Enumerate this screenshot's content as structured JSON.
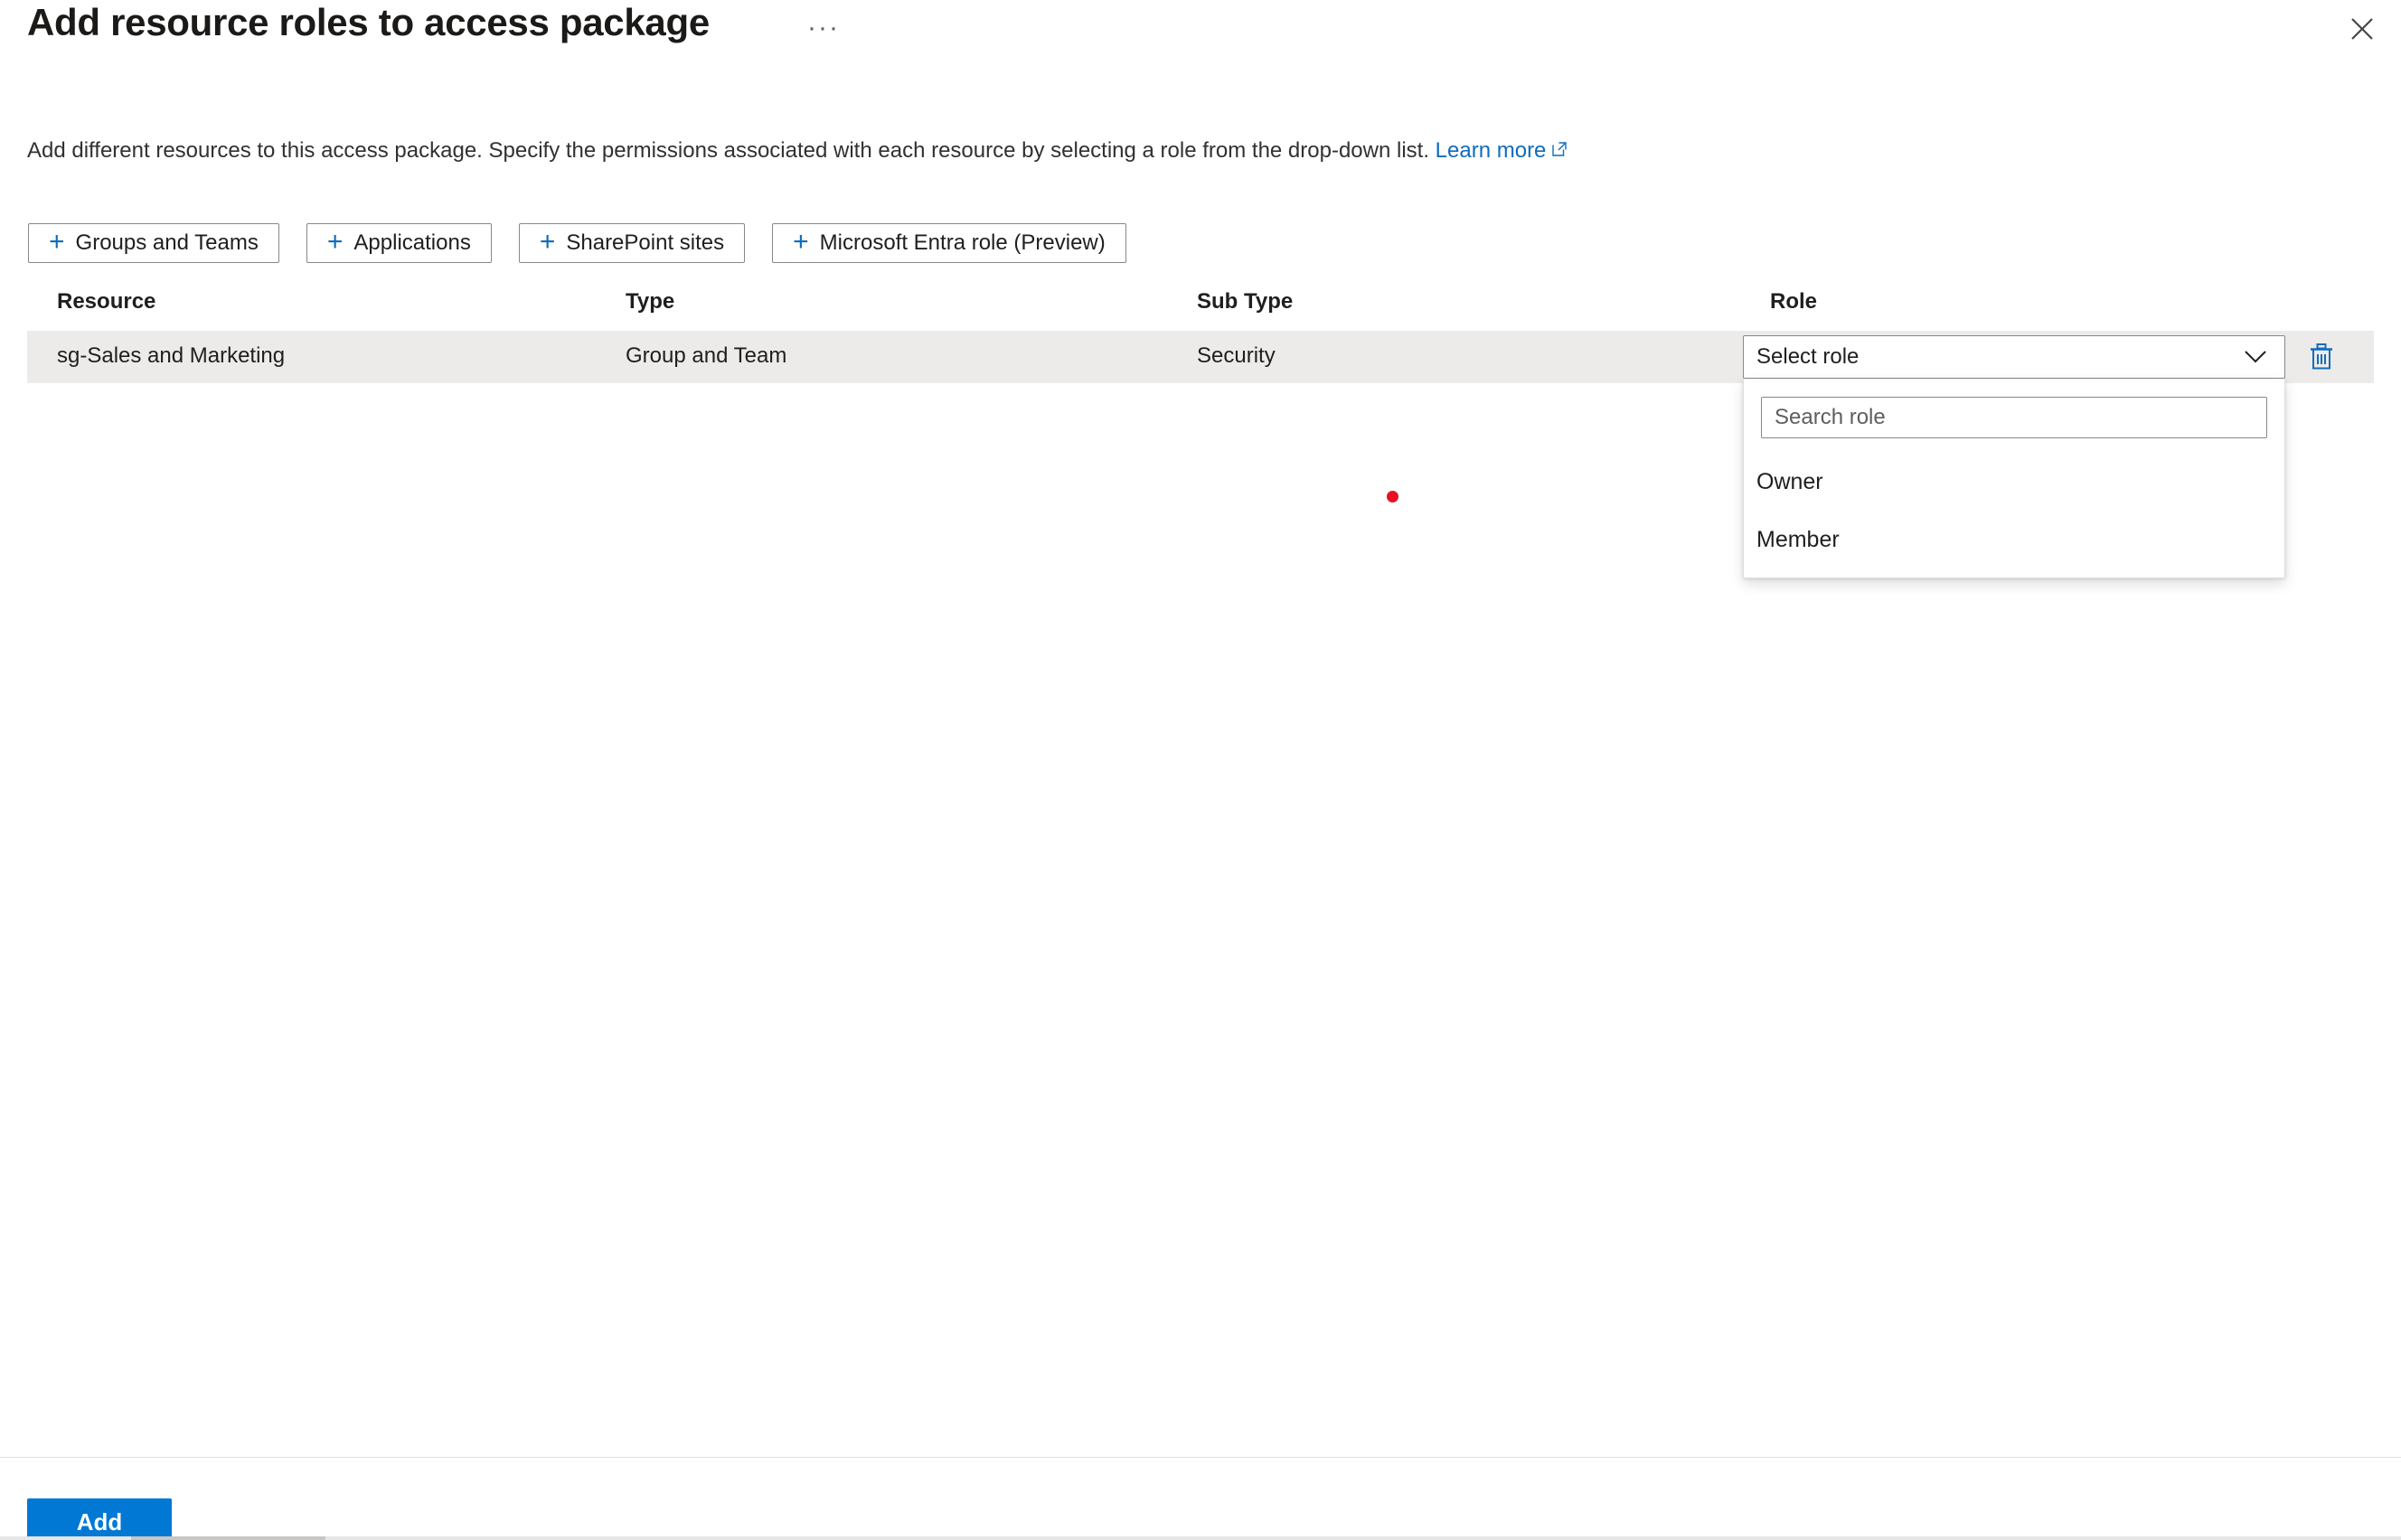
{
  "header": {
    "title": "Add resource roles to access package",
    "ellipsis_label": "···",
    "close_icon": "close-icon"
  },
  "description": {
    "text_before_link": "Add different resources to this access package. Specify the permissions associated with each resource by selecting a role from the drop-down list. ",
    "link_label": "Learn more",
    "link_icon": "external-link-icon"
  },
  "command_bar": {
    "buttons": [
      {
        "label": "Groups and Teams",
        "icon": "plus-icon"
      },
      {
        "label": "Applications",
        "icon": "plus-icon"
      },
      {
        "label": "SharePoint sites",
        "icon": "plus-icon"
      },
      {
        "label": "Microsoft Entra role (Preview)",
        "icon": "plus-icon"
      }
    ]
  },
  "table": {
    "columns": [
      "Resource",
      "Type",
      "Sub Type",
      "Role"
    ],
    "rows": [
      {
        "resource": "sg-Sales and Marketing",
        "type": "Group and Team",
        "sub_type": "Security",
        "role_value": "Select role",
        "delete_icon": "trash-icon"
      }
    ]
  },
  "role_dropdown": {
    "expanded": true,
    "search_placeholder": "Search role",
    "search_value": "",
    "options": [
      "Owner",
      "Member"
    ]
  },
  "footer": {
    "add_label": "Add"
  },
  "colors": {
    "accent": "#0078d4",
    "link": "#0f6cbd",
    "row_background": "#edebe9",
    "border": "#8a8886",
    "cursor_marker": "#e81123"
  }
}
